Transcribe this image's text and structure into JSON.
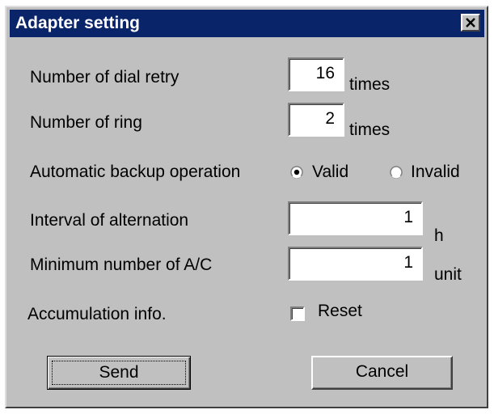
{
  "window": {
    "title": "Adapter setting",
    "close_icon": "close-icon"
  },
  "fields": {
    "dial_retry": {
      "label": "Number of dial retry",
      "value": "16",
      "unit": "times"
    },
    "ring": {
      "label": "Number of ring",
      "value": "2",
      "unit": "times"
    },
    "alternation": {
      "label": "Interval of alternation",
      "value": "1",
      "unit": "h"
    },
    "min_ac": {
      "label": "Minimum number of A/C",
      "value": "1",
      "unit": "unit"
    }
  },
  "backup": {
    "label": "Automatic backup operation",
    "options": [
      {
        "label": "Valid",
        "selected": true
      },
      {
        "label": "Invalid",
        "selected": false
      }
    ]
  },
  "accumulation": {
    "label": "Accumulation info.",
    "checkbox_label": "Reset",
    "checked": false
  },
  "buttons": {
    "send": "Send",
    "cancel": "Cancel"
  },
  "colors": {
    "titlebar": "#0a246a",
    "face": "#c0c0c0"
  }
}
